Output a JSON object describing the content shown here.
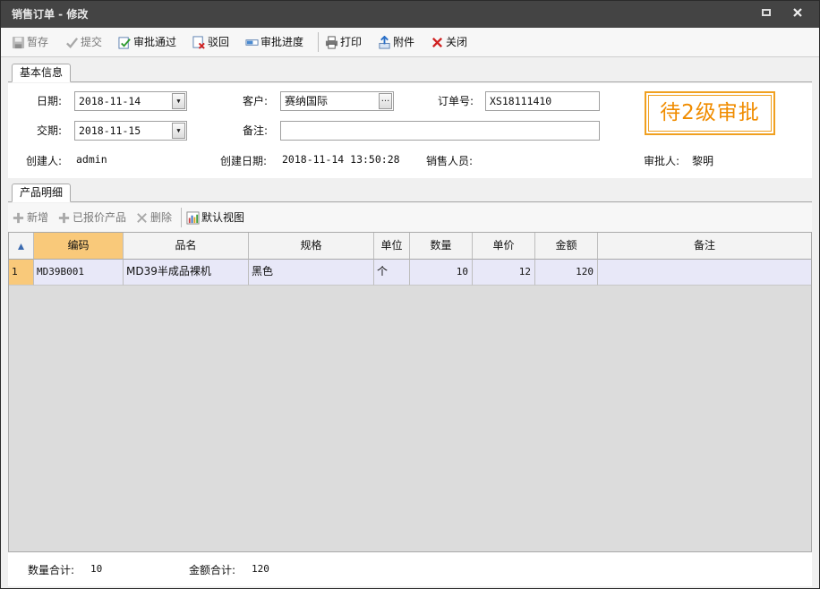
{
  "window": {
    "title": "销售订单 - 修改"
  },
  "toolbar": {
    "save": "暂存",
    "submit": "提交",
    "approve": "审批通过",
    "reject": "驳回",
    "progress": "审批进度",
    "print": "打印",
    "attach": "附件",
    "close": "关闭"
  },
  "tabs": {
    "basic": "基本信息",
    "products": "产品明细"
  },
  "form": {
    "date_label": "日期:",
    "date_value": "2018-11-14",
    "delivery_label": "交期:",
    "delivery_value": "2018-11-15",
    "customer_label": "客户:",
    "customer_value": "赛纳国际",
    "remark_label": "备注:",
    "remark_value": "",
    "order_no_label": "订单号:",
    "order_no_value": "XS18111410",
    "creator_label": "创建人:",
    "creator_value": "admin",
    "created_label": "创建日期:",
    "created_value": "2018-11-14 13:50:28",
    "sales_label": "销售人员:",
    "sales_value": "",
    "approver_label": "审批人:",
    "approver_value": "黎明",
    "status_stamp": "待2级审批"
  },
  "subtoolbar": {
    "add": "新增",
    "quoted": "已报价产品",
    "delete": "删除",
    "default_view": "默认视图"
  },
  "grid": {
    "columns": [
      "编码",
      "品名",
      "规格",
      "单位",
      "数量",
      "单价",
      "金额",
      "备注"
    ],
    "rows": [
      {
        "index": "1",
        "code": "MD39B001",
        "name": "MD39半成品裸机",
        "spec": "黑色",
        "unit": "个",
        "qty": "10",
        "price": "12",
        "amount": "120",
        "remark": ""
      }
    ]
  },
  "footer": {
    "qty_total_label": "数量合计:",
    "qty_total_value": "10",
    "amount_total_label": "金额合计:",
    "amount_total_value": "120"
  },
  "colors": {
    "stamp": "#f08c00",
    "sorted_header": "#f9c97a",
    "selected_row": "#e8e8f8",
    "titlebar": "#444444"
  },
  "icons": [
    "save-icon",
    "check-icon",
    "approve-icon",
    "reject-icon",
    "progress-icon",
    "printer-icon",
    "attachment-icon",
    "close-icon",
    "plus-icon",
    "delete-icon",
    "chart-icon",
    "sort-icon"
  ]
}
